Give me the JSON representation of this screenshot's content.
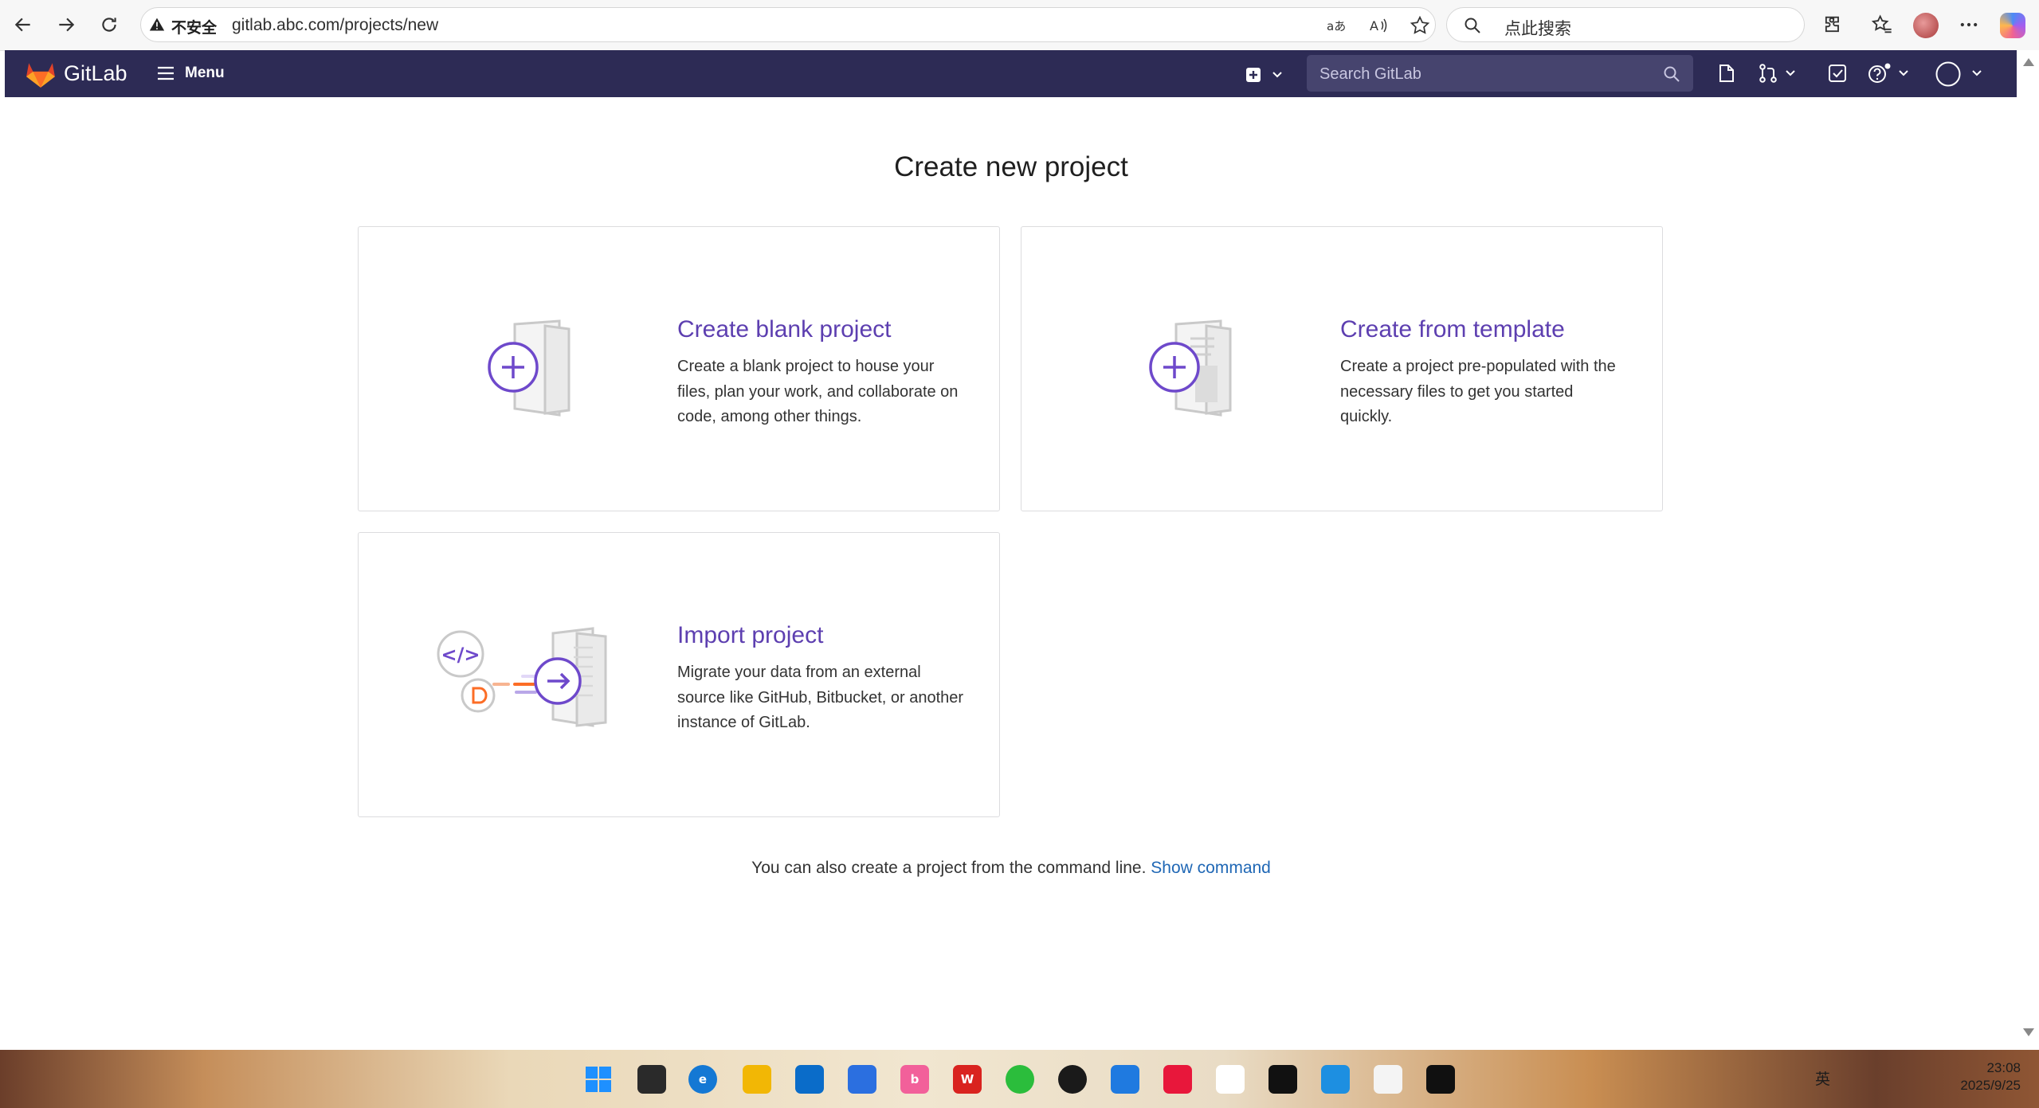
{
  "browser": {
    "security_label": "不安全",
    "url": "gitlab.abc.com/projects/new",
    "search_placeholder": "点此搜索"
  },
  "header": {
    "brand": "GitLab",
    "menu_label": "Menu",
    "search_placeholder": "Search GitLab"
  },
  "main": {
    "title": "Create new project",
    "cards": [
      {
        "title": "Create blank project",
        "description": "Create a blank project to house your files, plan your work, and collaborate on code, among other things.",
        "icon": "blank-project-illustration"
      },
      {
        "title": "Create from template",
        "description": "Create a project pre-populated with the necessary files to get you started quickly.",
        "icon": "template-project-illustration"
      },
      {
        "title": "Import project",
        "description": "Migrate your data from an external source like GitHub, Bitbucket, or another instance of GitLab.",
        "icon": "import-project-illustration"
      }
    ],
    "footer_text": "You can also create a project from the command line.",
    "footer_link": "Show command"
  },
  "taskbar": {
    "language": "英",
    "time": "23:08",
    "date": "2025/9/25"
  },
  "colors": {
    "header_bg": "#2d2b55",
    "accent_purple": "#5d3fb0",
    "link_blue": "#1f67b5"
  }
}
